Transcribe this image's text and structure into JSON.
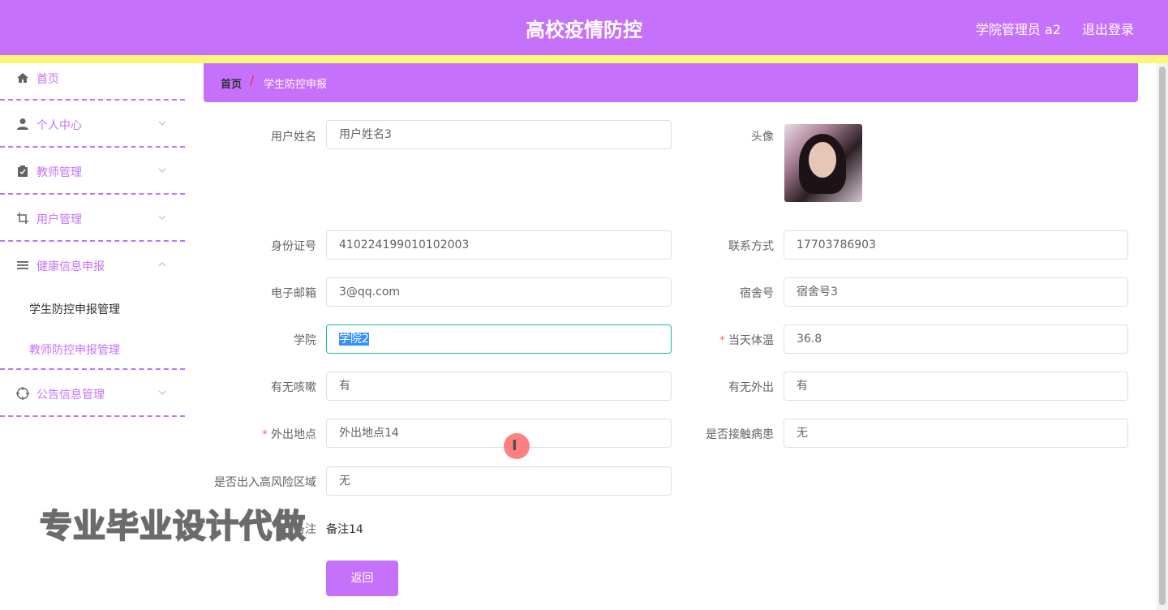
{
  "header": {
    "title": "高校疫情防控",
    "user": "学院管理员 a2",
    "logout": "退出登录"
  },
  "sidebar": {
    "items": [
      {
        "label": "首页",
        "icon": "home-icon"
      },
      {
        "label": "个人中心",
        "icon": "user-icon"
      },
      {
        "label": "教师管理",
        "icon": "clipboard-icon"
      },
      {
        "label": "用户管理",
        "icon": "crop-icon"
      },
      {
        "label": "健康信息申报",
        "icon": "list-icon"
      },
      {
        "label": "公告信息管理",
        "icon": "target-icon"
      }
    ],
    "submenu": [
      {
        "label": "学生防控申报管理"
      },
      {
        "label": "教师防控申报管理"
      }
    ]
  },
  "breadcrumb": {
    "home": "首页",
    "separator": "/",
    "current": "学生防控申报"
  },
  "form": {
    "username": {
      "label": "用户姓名",
      "value": "用户姓名3"
    },
    "avatar": {
      "label": "头像"
    },
    "idcard": {
      "label": "身份证号",
      "value": "410224199010102003"
    },
    "phone": {
      "label": "联系方式",
      "value": "17703786903"
    },
    "email": {
      "label": "电子邮箱",
      "value": "3@qq.com"
    },
    "dorm": {
      "label": "宿舍号",
      "value": "宿舍号3"
    },
    "college": {
      "label": "学院",
      "value": "学院2"
    },
    "temperature": {
      "label": "当天体温",
      "value": "36.8"
    },
    "cough": {
      "label": "有无咳嗽",
      "value": "有"
    },
    "out": {
      "label": "有无外出",
      "value": "有"
    },
    "location": {
      "label": "外出地点",
      "value": "外出地点14"
    },
    "contact": {
      "label": "是否接触病患",
      "value": "无"
    },
    "risk_area": {
      "label": "是否出入高风险区域",
      "value": "无"
    },
    "remark": {
      "label": "备注",
      "value": "备注14"
    },
    "back_button": "返回"
  },
  "watermark": "专业毕业设计代做",
  "cursor_glyph": "I"
}
